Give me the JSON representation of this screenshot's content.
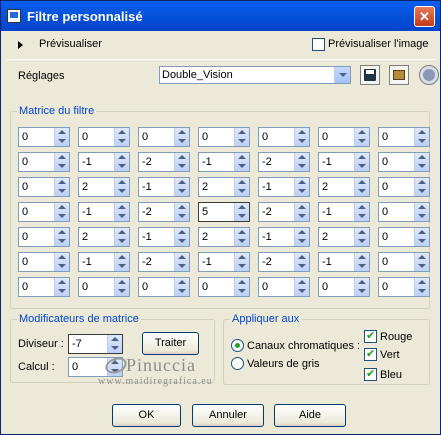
{
  "window": {
    "title": "Filtre personnalisé",
    "close_glyph": "✕"
  },
  "preview": {
    "label": "Prévisualiser",
    "image_checkbox_label": "Prévisualiser l'image",
    "image_checked": false
  },
  "presets": {
    "label": "Réglages",
    "selected": "Double_Vision"
  },
  "matrix": {
    "title": "Matrice du filtre",
    "rows": [
      [
        "0",
        "0",
        "0",
        "0",
        "0",
        "0",
        "0"
      ],
      [
        "0",
        "-1",
        "-2",
        "-1",
        "-2",
        "-1",
        "0"
      ],
      [
        "0",
        "2",
        "-1",
        "2",
        "-1",
        "2",
        "0"
      ],
      [
        "0",
        "-1",
        "-2",
        "5",
        "-2",
        "-1",
        "0"
      ],
      [
        "0",
        "2",
        "-1",
        "2",
        "-1",
        "2",
        "0"
      ],
      [
        "0",
        "-1",
        "-2",
        "-1",
        "-2",
        "-1",
        "0"
      ],
      [
        "0",
        "0",
        "0",
        "0",
        "0",
        "0",
        "0"
      ]
    ]
  },
  "modifiers": {
    "title": "Modificateurs de matrice",
    "divisor_label": "Diviseur :",
    "divisor_value": "-7",
    "bias_label": "Calcul :",
    "bias_value": "0",
    "auto_button": "Traiter"
  },
  "apply": {
    "title": "Appliquer aux",
    "color_channels": "Canaux chromatiques :",
    "grey_values": "Valeurs de gris",
    "red": "Rouge",
    "green": "Vert",
    "blue": "Bleu"
  },
  "watermark": {
    "name": "Pinuccia",
    "url": "www.maidiregrafica.eu"
  },
  "buttons": {
    "ok": "OK",
    "cancel": "Annuler",
    "help": "Aide"
  }
}
